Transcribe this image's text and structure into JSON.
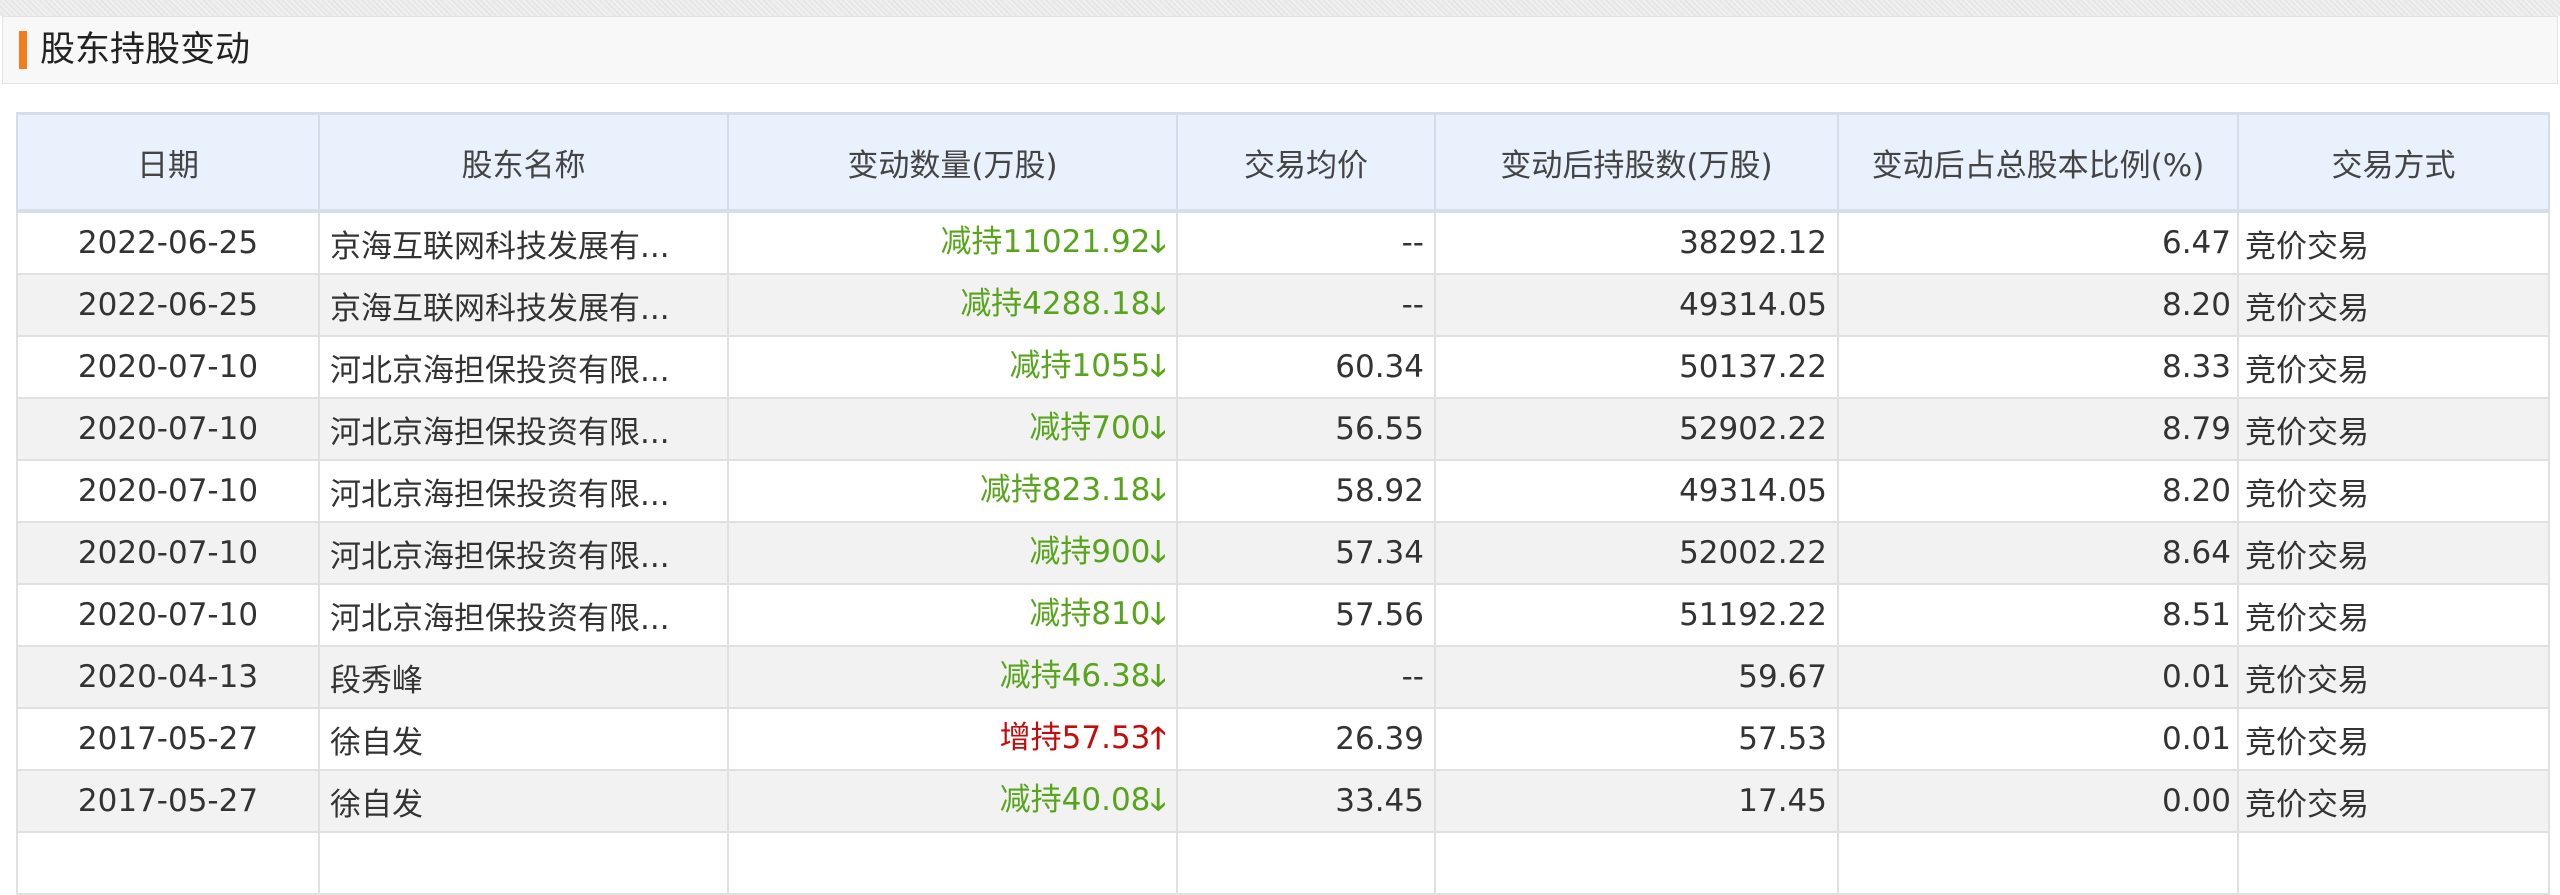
{
  "section": {
    "title": "股东持股变动",
    "accent_color": "#f47c1d"
  },
  "table": {
    "headers": [
      "日期",
      "股东名称",
      "变动数量(万股)",
      "交易均价",
      "变动后持股数(万股)",
      "变动后占总股本比例(%)",
      "交易方式"
    ],
    "rows": [
      {
        "date": "2022-06-25",
        "holder": "京海互联网科技发展有...",
        "change": "减持11021.92",
        "dir": "down",
        "arrow": "🡓",
        "price": "--",
        "after": "38292.12",
        "ratio": "6.47",
        "method": "竞价交易"
      },
      {
        "date": "2022-06-25",
        "holder": "京海互联网科技发展有...",
        "change": "减持4288.18",
        "dir": "down",
        "arrow": "🡓",
        "price": "--",
        "after": "49314.05",
        "ratio": "8.20",
        "method": "竞价交易"
      },
      {
        "date": "2020-07-10",
        "holder": "河北京海担保投资有限...",
        "change": "减持1055",
        "dir": "down",
        "arrow": "🡓",
        "price": "60.34",
        "after": "50137.22",
        "ratio": "8.33",
        "method": "竞价交易"
      },
      {
        "date": "2020-07-10",
        "holder": "河北京海担保投资有限...",
        "change": "减持700",
        "dir": "down",
        "arrow": "🡓",
        "price": "56.55",
        "after": "52902.22",
        "ratio": "8.79",
        "method": "竞价交易"
      },
      {
        "date": "2020-07-10",
        "holder": "河北京海担保投资有限...",
        "change": "减持823.18",
        "dir": "down",
        "arrow": "🡓",
        "price": "58.92",
        "after": "49314.05",
        "ratio": "8.20",
        "method": "竞价交易"
      },
      {
        "date": "2020-07-10",
        "holder": "河北京海担保投资有限...",
        "change": "减持900",
        "dir": "down",
        "arrow": "🡓",
        "price": "57.34",
        "after": "52002.22",
        "ratio": "8.64",
        "method": "竞价交易"
      },
      {
        "date": "2020-07-10",
        "holder": "河北京海担保投资有限...",
        "change": "减持810",
        "dir": "down",
        "arrow": "🡓",
        "price": "57.56",
        "after": "51192.22",
        "ratio": "8.51",
        "method": "竞价交易"
      },
      {
        "date": "2020-04-13",
        "holder": "段秀峰",
        "change": "减持46.38",
        "dir": "down",
        "arrow": "🡓",
        "price": "--",
        "after": "59.67",
        "ratio": "0.01",
        "method": "竞价交易"
      },
      {
        "date": "2017-05-27",
        "holder": "徐自发",
        "change": "增持57.53",
        "dir": "up",
        "arrow": "🡑",
        "price": "26.39",
        "after": "57.53",
        "ratio": "0.01",
        "method": "竞价交易"
      },
      {
        "date": "2017-05-27",
        "holder": "徐自发",
        "change": "减持40.08",
        "dir": "down",
        "arrow": "🡓",
        "price": "33.45",
        "after": "17.45",
        "ratio": "0.00",
        "method": "竞价交易"
      }
    ]
  },
  "colors": {
    "decrease": "#58a51d",
    "increase": "#c30d0d",
    "header_bg": "#e8f1fc"
  }
}
